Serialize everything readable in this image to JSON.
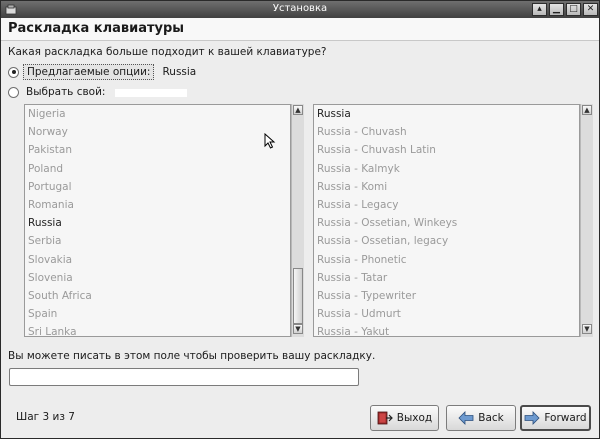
{
  "window": {
    "title": "Установка"
  },
  "header": {
    "title": "Раскладка клавиатуры"
  },
  "question": "Какая раскладка больше подходит к вашей клавиатуре?",
  "suggested": {
    "label": "Предлагаемые опции:",
    "value": "Russia",
    "selected": true
  },
  "custom": {
    "label": "Выбрать свой:",
    "selected": false
  },
  "countries": {
    "items": [
      "Nigeria",
      "Norway",
      "Pakistan",
      "Poland",
      "Portugal",
      "Romania",
      "Russia",
      "Serbia",
      "Slovakia",
      "Slovenia",
      "South Africa",
      "Spain",
      "Sri Lanka"
    ],
    "selected": "Russia"
  },
  "variants": {
    "items": [
      "Russia",
      "Russia - Chuvash",
      "Russia - Chuvash Latin",
      "Russia - Kalmyk",
      "Russia - Komi",
      "Russia - Legacy",
      "Russia - Ossetian, Winkeys",
      "Russia - Ossetian, legacy",
      "Russia - Phonetic",
      "Russia - Tatar",
      "Russia - Typewriter",
      "Russia - Udmurt",
      "Russia - Yakut"
    ],
    "selected": "Russia"
  },
  "test": {
    "label": "Вы можете писать в этом поле чтобы проверить вашу раскладку.",
    "value": ""
  },
  "footer": {
    "step": "Шаг 3 из 7",
    "quit": "Выход",
    "back": "Back",
    "forward": "Forward"
  },
  "icons": {
    "quit": "quit-icon",
    "back": "back-arrow-icon",
    "forward": "forward-arrow-icon"
  }
}
